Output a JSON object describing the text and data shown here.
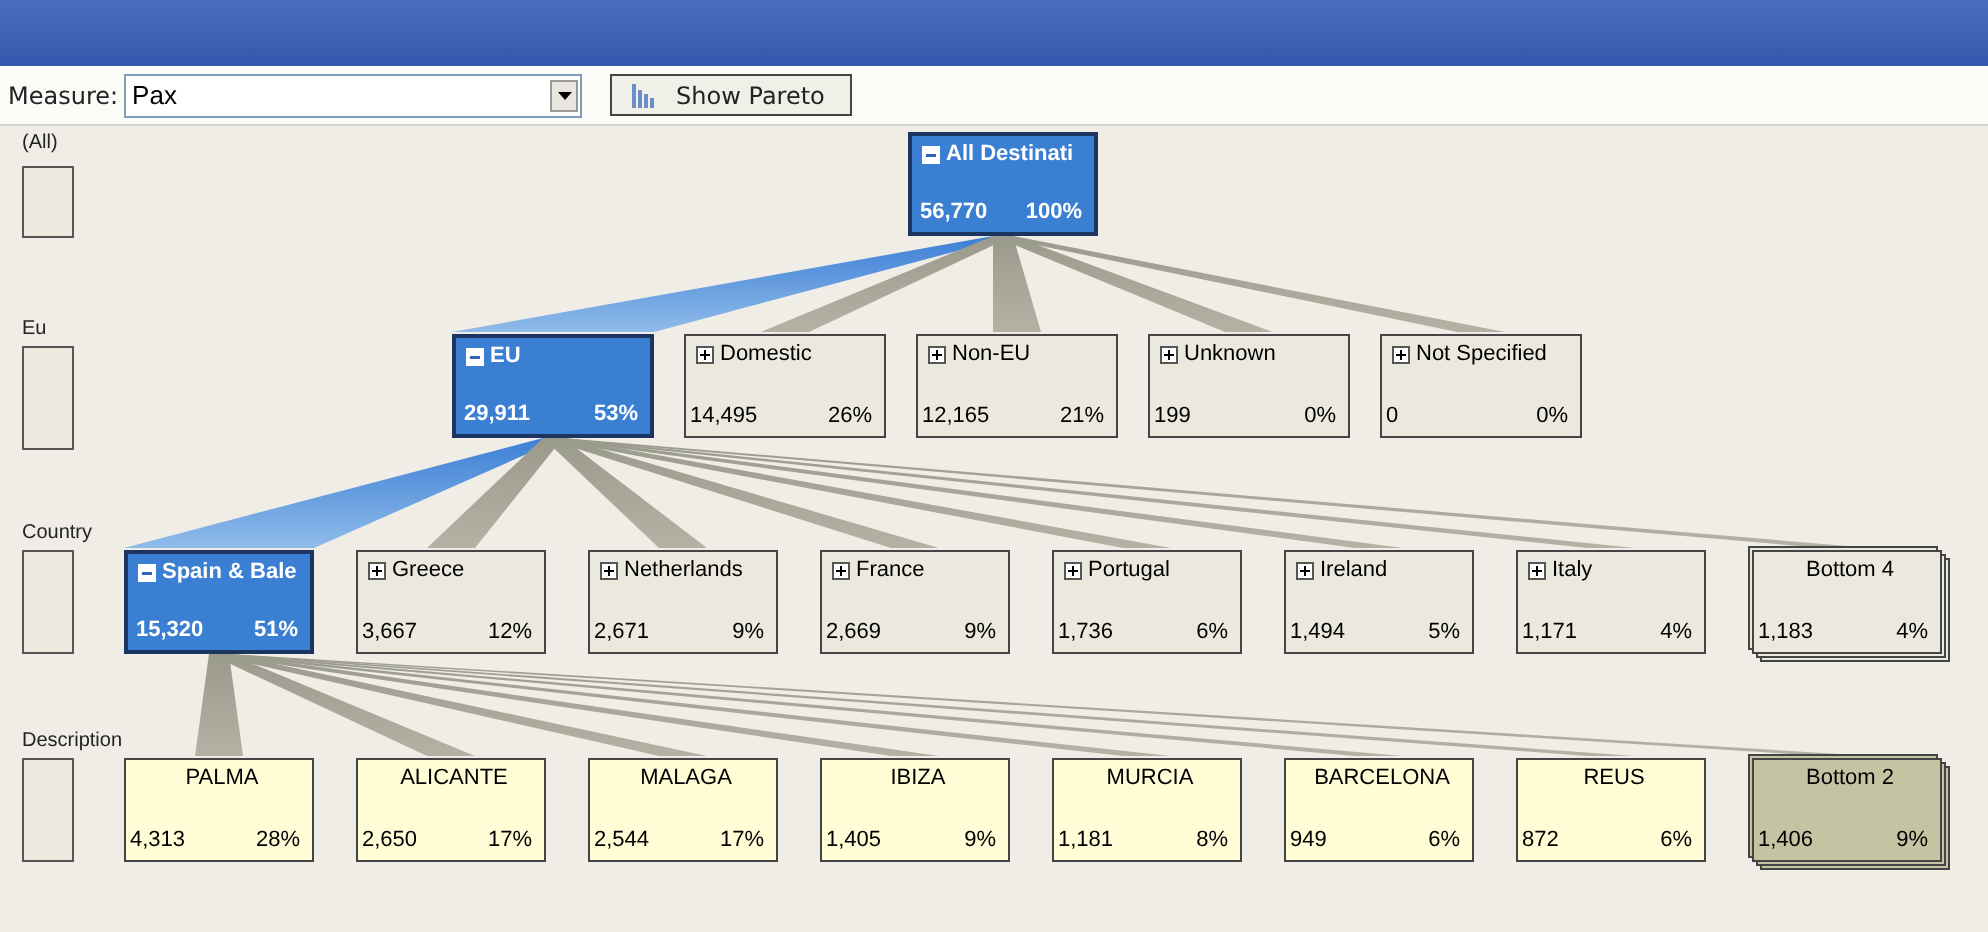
{
  "toolbar": {
    "measure_label": "Measure:",
    "measure_value": "Pax",
    "pareto_button": "Show Pareto"
  },
  "levels": [
    {
      "label": "(All)",
      "nodes": [
        {
          "kind": "member",
          "name": "All Destinati",
          "value": "56,770",
          "percent": "100%",
          "expanded": true
        }
      ]
    },
    {
      "label": "Eu",
      "nodes": [
        {
          "kind": "member",
          "name": "EU",
          "value": "29,911",
          "percent": "53%",
          "expanded": true
        },
        {
          "kind": "member",
          "name": "Domestic",
          "value": "14,495",
          "percent": "26%",
          "expanded": false
        },
        {
          "kind": "member",
          "name": "Non-EU",
          "value": "12,165",
          "percent": "21%",
          "expanded": false
        },
        {
          "kind": "member",
          "name": "Unknown",
          "value": "199",
          "percent": "0%",
          "expanded": false
        },
        {
          "kind": "member",
          "name": "Not Specified",
          "value": "0",
          "percent": "0%",
          "expanded": false
        }
      ]
    },
    {
      "label": "Country",
      "nodes": [
        {
          "kind": "member",
          "name": "Spain & Bale",
          "value": "15,320",
          "percent": "51%",
          "expanded": true
        },
        {
          "kind": "member",
          "name": "Greece",
          "value": "3,667",
          "percent": "12%",
          "expanded": false
        },
        {
          "kind": "member",
          "name": "Netherlands",
          "value": "2,671",
          "percent": "9%",
          "expanded": false
        },
        {
          "kind": "member",
          "name": "France",
          "value": "2,669",
          "percent": "9%",
          "expanded": false
        },
        {
          "kind": "member",
          "name": "Portugal",
          "value": "1,736",
          "percent": "6%",
          "expanded": false
        },
        {
          "kind": "member",
          "name": "Ireland",
          "value": "1,494",
          "percent": "5%",
          "expanded": false
        },
        {
          "kind": "member",
          "name": "Italy",
          "value": "1,171",
          "percent": "4%",
          "expanded": false
        },
        {
          "kind": "group",
          "name": "Bottom 4",
          "value": "1,183",
          "percent": "4%",
          "selected": false
        }
      ]
    },
    {
      "label": "Description",
      "nodes": [
        {
          "kind": "leaf",
          "name": "PALMA",
          "value": "4,313",
          "percent": "28%"
        },
        {
          "kind": "leaf",
          "name": "ALICANTE",
          "value": "2,650",
          "percent": "17%"
        },
        {
          "kind": "leaf",
          "name": "MALAGA",
          "value": "2,544",
          "percent": "17%"
        },
        {
          "kind": "leaf",
          "name": "IBIZA",
          "value": "1,405",
          "percent": "9%"
        },
        {
          "kind": "leaf",
          "name": "MURCIA",
          "value": "1,181",
          "percent": "8%"
        },
        {
          "kind": "leaf",
          "name": "BARCELONA",
          "value": "949",
          "percent": "6%"
        },
        {
          "kind": "leaf",
          "name": "REUS",
          "value": "872",
          "percent": "6%"
        },
        {
          "kind": "group",
          "name": "Bottom 2",
          "value": "1,406",
          "percent": "9%",
          "selected": true
        }
      ]
    }
  ]
}
